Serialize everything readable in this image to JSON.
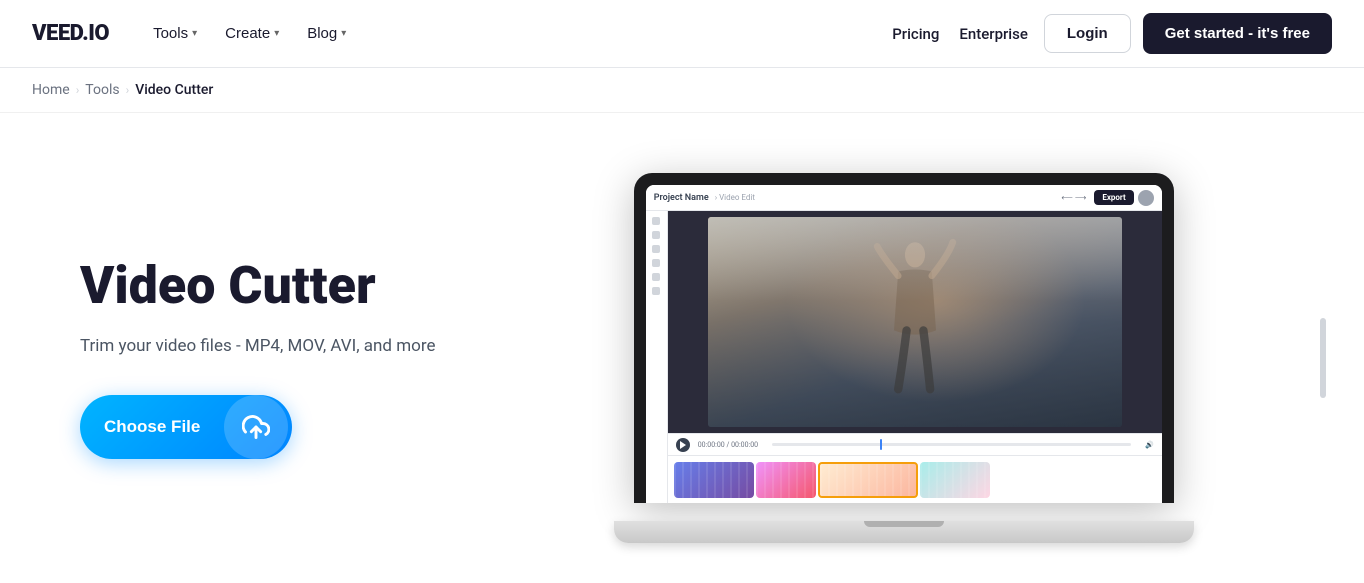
{
  "nav": {
    "logo": "VEED.IO",
    "menu": [
      {
        "label": "Tools",
        "has_dropdown": true
      },
      {
        "label": "Create",
        "has_dropdown": true
      },
      {
        "label": "Blog",
        "has_dropdown": true
      }
    ],
    "right_links": [
      {
        "label": "Pricing"
      },
      {
        "label": "Enterprise"
      }
    ],
    "login_label": "Login",
    "cta_label": "Get started - it's free"
  },
  "breadcrumb": {
    "items": [
      "Home",
      "Tools",
      "Video Cutter"
    ]
  },
  "hero": {
    "title": "Video Cutter",
    "subtitle": "Trim your video files - MP4, MOV, AVI, and more",
    "choose_file_label": "Choose File"
  },
  "editor": {
    "project_name": "Project Name",
    "export_label": "Export",
    "time": "00:00:00 / 00:00:00"
  }
}
